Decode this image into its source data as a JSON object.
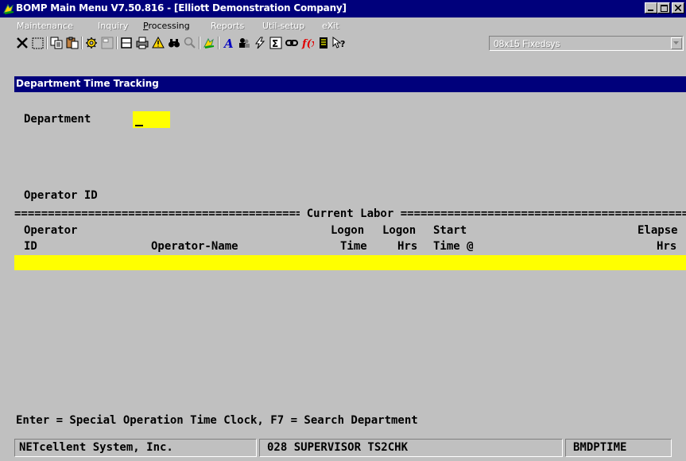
{
  "window": {
    "title": "BOMP Main Menu V7.50.816 - [Elliott Demonstration Company]"
  },
  "menu": {
    "items": [
      {
        "label": "Maintenance",
        "enabled": false
      },
      {
        "label": "Inquiry",
        "enabled": false
      },
      {
        "label": "Processing",
        "enabled": true
      },
      {
        "label": "Reports",
        "enabled": false
      },
      {
        "label": "Util-setup",
        "enabled": false
      },
      {
        "label": "eXit",
        "enabled": false
      }
    ]
  },
  "toolbar": {
    "font_value": "08x15 Fixedsys"
  },
  "screen": {
    "title": "Department Time Tracking",
    "department_label": "Department",
    "operator_id_label": "Operator ID",
    "section_label": " Current Labor ",
    "columns_row1": {
      "operator": "Operator",
      "logon": "Logon",
      "logon2": "Logon",
      "start": "Start",
      "elapse": "Elapse"
    },
    "columns_row2": {
      "id": "ID",
      "operator_name": "Operator-Name",
      "time": "Time",
      "hrs": "Hrs",
      "time_at": "Time @",
      "hrs2": "Hrs"
    },
    "help_line": "Enter = Special Operation Time Clock, F7 = Search Department"
  },
  "status": {
    "company": "NETcellent System, Inc.",
    "user": "028 SUPERVISOR TS2CHK",
    "program": "BMDPTIME"
  },
  "colors": {
    "titlebar": "#00007b",
    "input_field": "#ffff00",
    "background": "#c0c0c0"
  }
}
